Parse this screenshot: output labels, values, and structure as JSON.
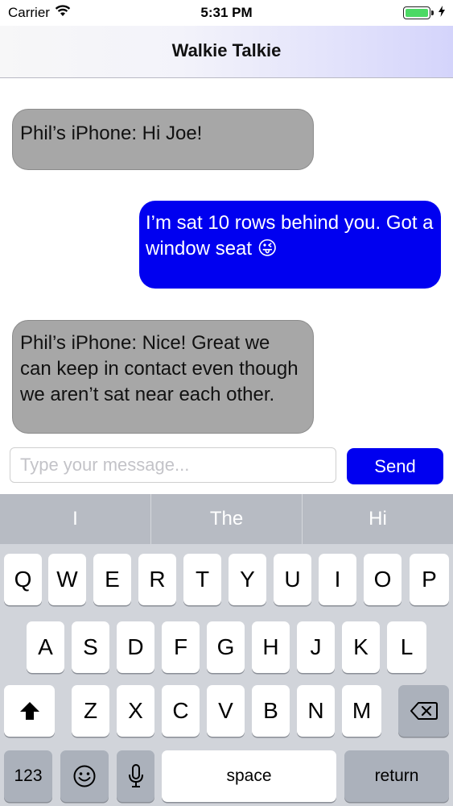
{
  "status_bar": {
    "carrier": "Carrier",
    "time": "5:31 PM"
  },
  "nav": {
    "title": "Walkie Talkie"
  },
  "messages": [
    {
      "direction": "incoming",
      "text": "Phil’s iPhone: Hi Joe!"
    },
    {
      "direction": "outgoing",
      "text": "I’m sat 10 rows behind you. Got a window seat 😜"
    },
    {
      "direction": "incoming",
      "text": "Phil’s iPhone: Nice! Great we can keep in contact even though we aren’t sat near each other."
    }
  ],
  "composer": {
    "placeholder": "Type your message...",
    "send_label": "Send"
  },
  "keyboard": {
    "suggestions": [
      "I",
      "The",
      "Hi"
    ],
    "row1": [
      "Q",
      "W",
      "E",
      "R",
      "T",
      "Y",
      "U",
      "I",
      "O",
      "P"
    ],
    "row2": [
      "A",
      "S",
      "D",
      "F",
      "G",
      "H",
      "J",
      "K",
      "L"
    ],
    "row3": [
      "Z",
      "X",
      "C",
      "V",
      "B",
      "N",
      "M"
    ],
    "numbers_label": "123",
    "space_label": "space",
    "return_label": "return"
  },
  "colors": {
    "outgoing_bubble": "#0000f0",
    "incoming_bubble": "#a7a7a7",
    "send_button": "#0000f0",
    "battery": "#4cd964"
  }
}
